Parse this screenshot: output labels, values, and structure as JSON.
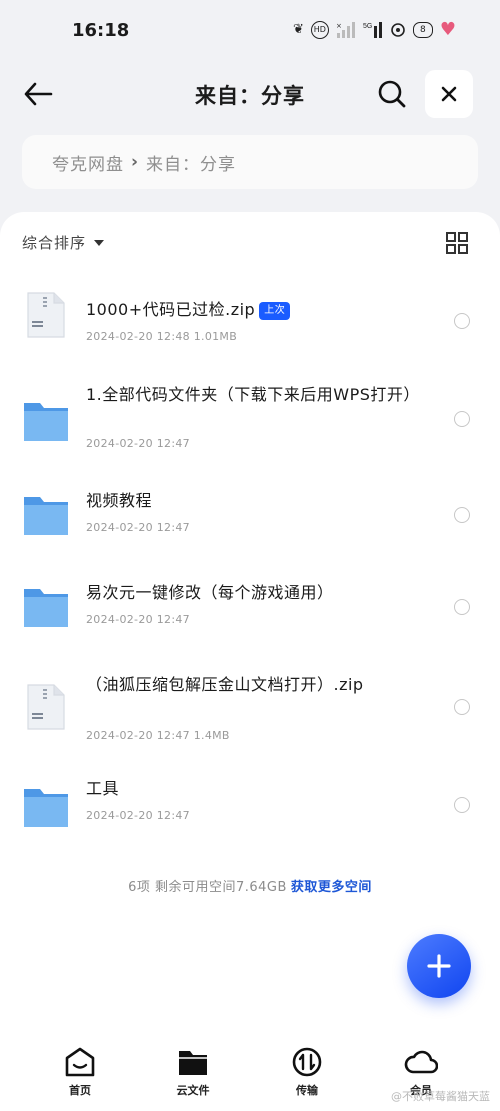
{
  "status_bar": {
    "time": "16:18",
    "icons": [
      "leaf-icon",
      "hd-icon",
      "signal-off-icon",
      "5g-signal-icon",
      "settings-badge-icon",
      "battery-icon",
      "heart-pin-icon"
    ],
    "battery": "8"
  },
  "header": {
    "title": "来自：分享"
  },
  "breadcrumb": {
    "root": "夸克网盘",
    "current": "来自：分享"
  },
  "sort": {
    "label": "综合排序"
  },
  "files": [
    {
      "name": "1000+代码已过检.zip",
      "meta": "2024-02-20 12:48  1.01MB",
      "type": "zip",
      "badge": "上次"
    },
    {
      "name": "1.全部代码文件夹（下载下来后用WPS打开）",
      "meta": "2024-02-20 12:47",
      "type": "folder"
    },
    {
      "name": "视频教程",
      "meta": "2024-02-20 12:47",
      "type": "folder"
    },
    {
      "name": "易次元一键修改（每个游戏通用）",
      "meta": "2024-02-20 12:47",
      "type": "folder"
    },
    {
      "name": "（油狐压缩包解压金山文档打开）.zip",
      "meta": "2024-02-20 12:47  1.4MB",
      "type": "zip"
    },
    {
      "name": "工具",
      "meta": "2024-02-20 12:47",
      "type": "folder"
    }
  ],
  "footer": {
    "summary": "6项 剩余可用空间7.64GB",
    "link": "获取更多空间"
  },
  "nav": [
    {
      "label": "首页",
      "icon": "home-icon"
    },
    {
      "label": "云文件",
      "icon": "cloud-folder-icon"
    },
    {
      "label": "传输",
      "icon": "transfer-icon"
    },
    {
      "label": "会员",
      "icon": "cloud-member-icon"
    }
  ],
  "watermark": "@不败草莓酱猫天蓝",
  "colors": {
    "accent": "#1A5CFF",
    "folder": "#6FB3F2",
    "background": "#F1F2F5"
  }
}
